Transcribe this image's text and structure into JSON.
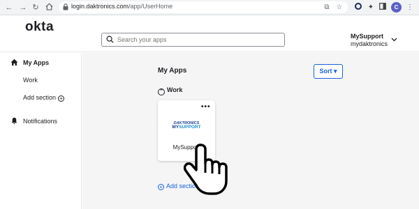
{
  "browser": {
    "url_domain": "login.daktronics.com",
    "url_path": "/app/UserHome",
    "profile_initial": "C"
  },
  "header": {
    "logo": "okta",
    "search_placeholder": "Search your apps",
    "user_name": "MySupport",
    "user_org": "mydaktronics"
  },
  "sidebar": {
    "items": [
      {
        "label": "My Apps",
        "icon": "home-icon"
      },
      {
        "label": "Work"
      },
      {
        "label": "Add section",
        "icon": "plus-circle-icon"
      },
      {
        "label": "Notifications",
        "icon": "bell-icon"
      }
    ]
  },
  "main": {
    "title": "My Apps",
    "sort_label": "Sort",
    "section_label": "Work",
    "add_section_label": "Add section"
  },
  "apps": [
    {
      "name": "MySupport",
      "logo_line1": "DAKTRONICS",
      "logo_line2a": "MY",
      "logo_line2b": "SUPPORT",
      "menu": "•••"
    }
  ],
  "colors": {
    "accent": "#1662dd",
    "main_bg": "#f5f5f6",
    "brand_dark": "#1a3d8f"
  }
}
